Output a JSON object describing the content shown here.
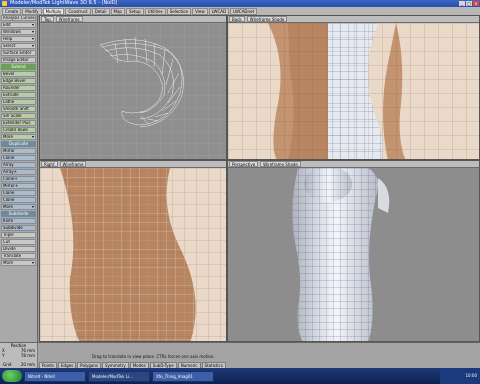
{
  "window": {
    "title": "Modeler/ModTek LightWave 3D 9.5 - (NoID)"
  },
  "tabs": [
    "Create",
    "Modify",
    "Multiply",
    "Construct",
    "Detail",
    "Map",
    "Setup",
    "Utilities",
    "Selection",
    "View",
    "LWCAD",
    "LWCADnet"
  ],
  "active_tab": "Multiply",
  "left_panel": {
    "top_items": [
      "Analysis Curves",
      "Edit",
      "Windows",
      "Help",
      "Select",
      "Surface Editor",
      "Image Editor"
    ],
    "extend_header": "Extend",
    "extend_items": [
      "Bevel",
      "Edge Bevel",
      "Rounder",
      "Extrude",
      "Lathe",
      "Smooth Shift",
      "Sm Scale",
      "Extender Plus",
      "Create Rows",
      "More"
    ],
    "duplicate_header": "Duplicate",
    "duplicate_items": [
      "Mirror",
      "Clone",
      "Array",
      "Array+",
      "Clone+",
      "Mirror+",
      "Clone",
      "Clone",
      "More"
    ],
    "subdivide_header": "Subdivide",
    "subdivide_items": [
      "Knife",
      "Subdivide"
    ],
    "bottom_items": [
      "Triple",
      "Cut",
      "Divide",
      "Translate",
      "More"
    ]
  },
  "viewports": {
    "top": {
      "view": "Top",
      "mode": "Wireframe"
    },
    "back": {
      "view": "Back",
      "mode": "Wireframe Shade"
    },
    "right": {
      "view": "Right",
      "mode": "Wireframe"
    },
    "perspective": {
      "view": "Perspective",
      "mode": "Wireframe Shade"
    }
  },
  "status": {
    "position_label": "Position",
    "x_label": "X",
    "x_value": "76 mm",
    "y_label": "Y",
    "y_value": "78 mm",
    "z_label": "Z",
    "z_value": "0 m",
    "grid_label": "Grid",
    "grid_value": "20 mm",
    "hint": "Drag to translate in view plane. CTRL forces one axis motion.",
    "bottom_tabs": [
      "Points",
      "Edges",
      "Polygons",
      "Symmetry",
      "Modes",
      "SubD-Type",
      "Numeric",
      "Statistics"
    ]
  },
  "taskbar": {
    "items": [
      "Nitrelt - Nitell",
      "Modeler/ModTek Li...",
      "Xfe_Thing_Imag01"
    ],
    "tray_time": "10:00"
  },
  "colors": {
    "viewport_bg": "#8f8f8f",
    "grid_line": "#b0b0b0",
    "skin": "#b88560",
    "mesh": "#3a4cb0",
    "clay": "#e6e9ee"
  }
}
